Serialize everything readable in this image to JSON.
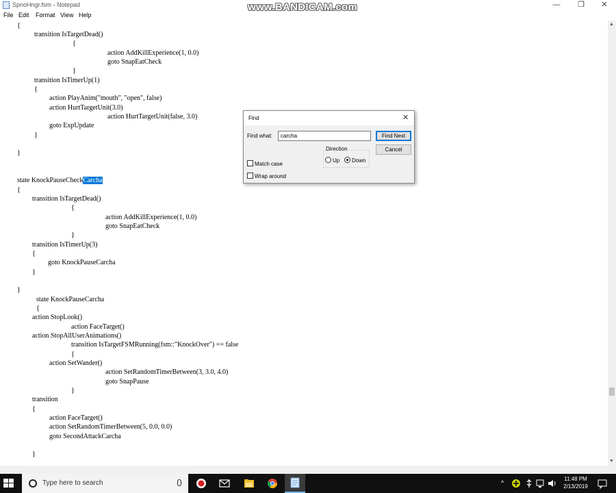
{
  "window": {
    "title": "SpnoHngr.fsm - Notepad",
    "minimize_glyph": "—",
    "restore_glyph": "❐",
    "close_glyph": "✕"
  },
  "watermark": "www.BANDICAM.com",
  "menu": [
    "File",
    "Edit",
    "Format",
    "View",
    "Help"
  ],
  "editor": {
    "lines": [
      "{",
      "transition IsTargetDead()",
      "{",
      "action AddKillExperience(1, 0.0)",
      "goto SnapEatCheck",
      "}",
      "transition IsTimerUp(1)",
      "{",
      "action PlayAnim(\"mouth\", \"open\", false)",
      "action HurtTargetUnit(3.0)",
      "action HurtTargetUnit(false, 3.0)",
      "goto ExpUpdate",
      "}",
      "}",
      "state KnockPauseCheck",
      "Carcha",
      "{",
      "transition IsTargetDead()",
      "{",
      "action AddKillExperience(1, 0.0)",
      "goto SnapEatCheck",
      "}",
      "transition IsTimerUp(3)",
      "{",
      "goto KnockPauseCarcha",
      "}",
      "}",
      "state KnockPauseCarcha",
      "{",
      "action StopLook()",
      "action FaceTarget()",
      "action StopAllUserAnimations()",
      "transition IsTargetFSMRunning(fsm::\"KnockOver\") == false",
      "{",
      "action SetWander()",
      "action SetRandomTimerBetween(3, 3.0, 4.0)",
      "goto SnapPause",
      "}",
      "transition",
      "{",
      "action FaceTarget()",
      "action SetRandomTimerBetween(5, 0.0, 0.0)",
      "goto SecondAttackCarcha",
      "}"
    ]
  },
  "find_dialog": {
    "title": "Find",
    "close_glyph": "✕",
    "find_what_label": "Find what:",
    "find_what_value": "carcha",
    "find_next_label": "Find Next",
    "cancel_label": "Cancel",
    "direction_label": "Direction",
    "up_label": "Up",
    "down_label": "Down",
    "direction_selected": "Down",
    "match_case_label": "Match case",
    "wrap_around_label": "Wrap around",
    "match_case_checked": false,
    "wrap_around_checked": false
  },
  "taskbar": {
    "search_placeholder": "Type here to search",
    "clock_time": "11:48 PM",
    "clock_date": "2/13/2019",
    "tray_chevron": "^"
  }
}
